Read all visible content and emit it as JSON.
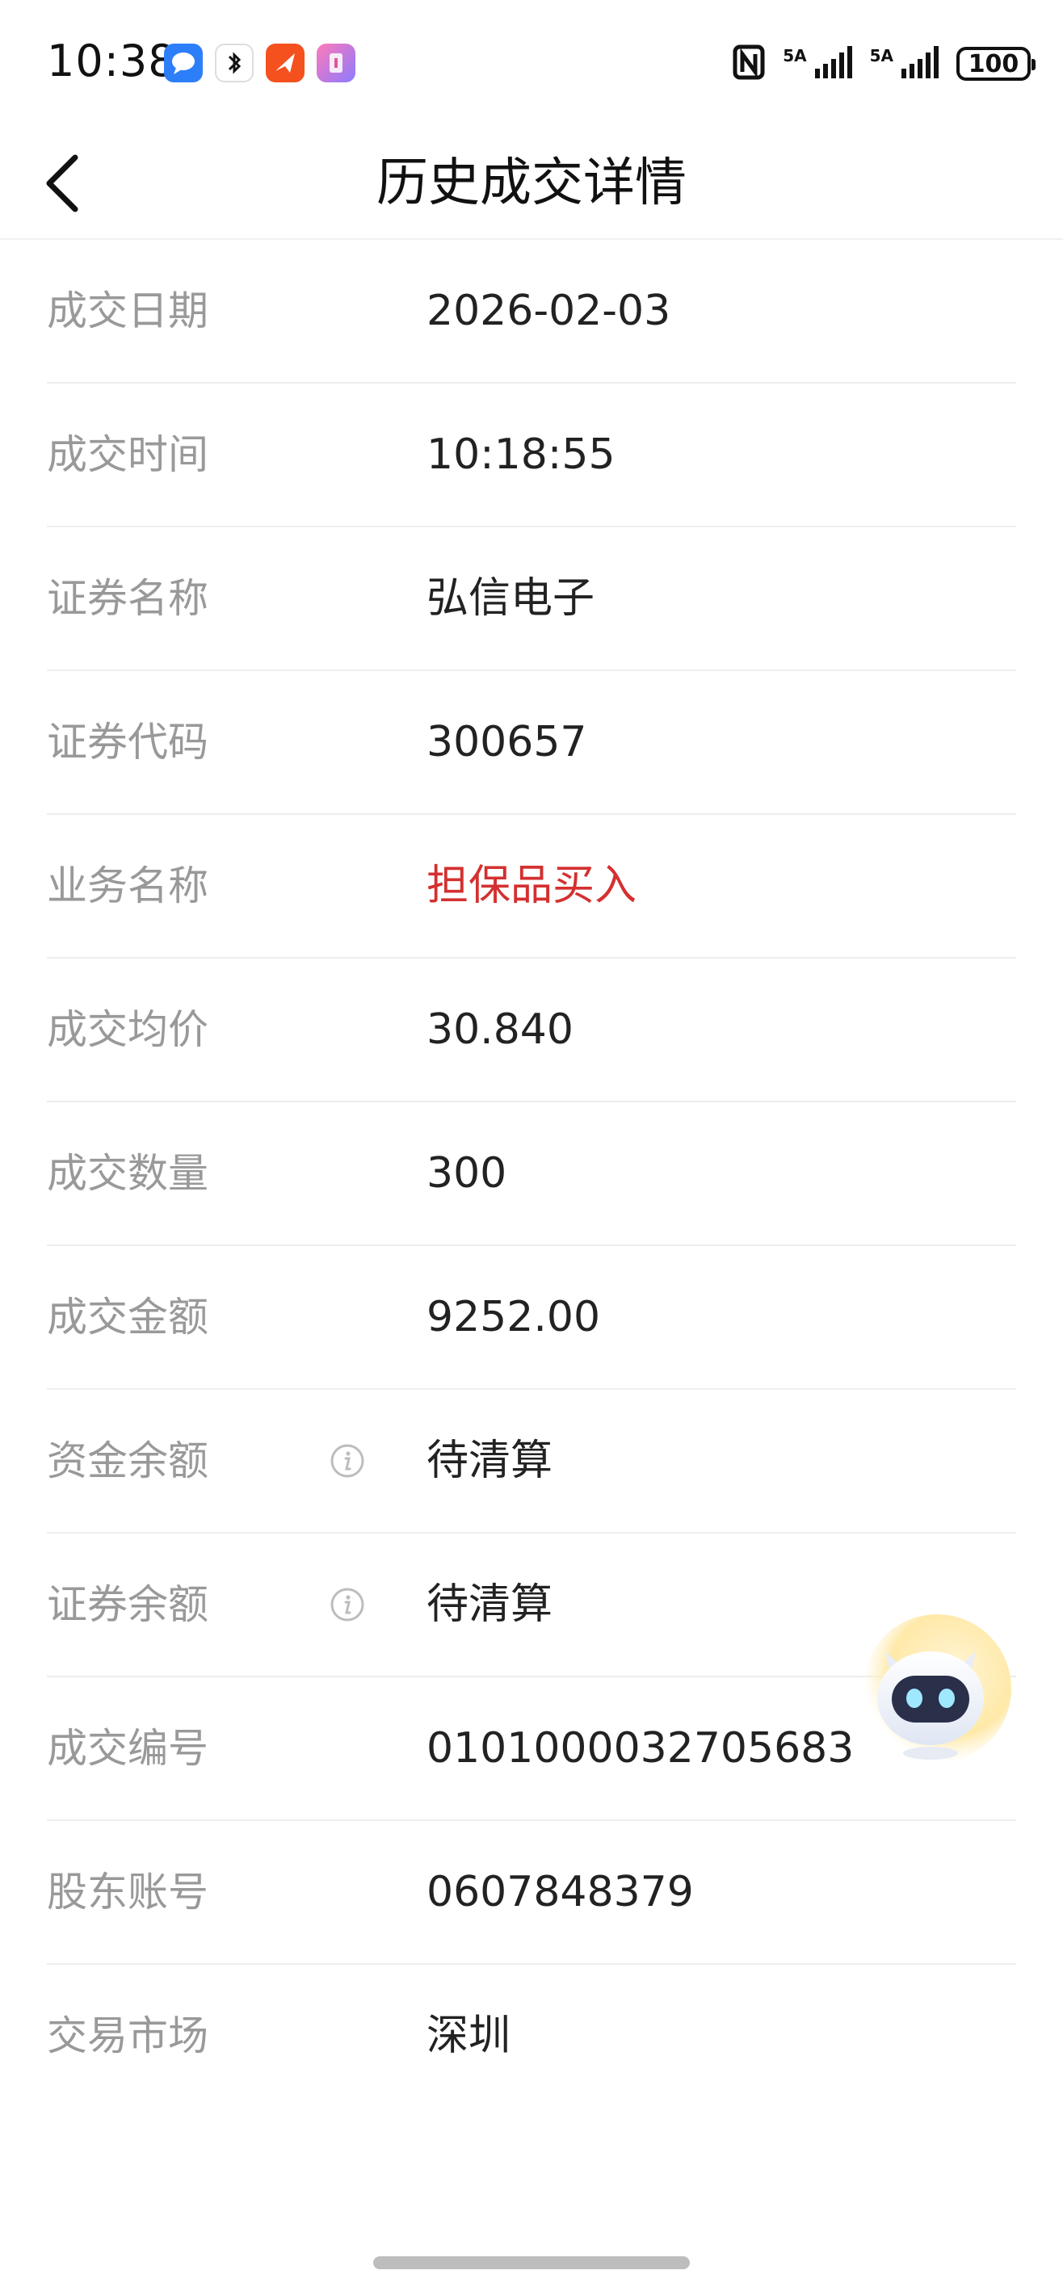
{
  "status_bar": {
    "time": "10:38",
    "network_1": "5A",
    "network_2": "5A",
    "battery": "100"
  },
  "header": {
    "title": "历史成交详情"
  },
  "details": [
    {
      "label": "成交日期",
      "value": "2026-02-03"
    },
    {
      "label": "成交时间",
      "value": "10:18:55"
    },
    {
      "label": "证券名称",
      "value": "弘信电子"
    },
    {
      "label": "证券代码",
      "value": "300657"
    },
    {
      "label": "业务名称",
      "value": "担保品买入"
    },
    {
      "label": "成交均价",
      "value": "30.840"
    },
    {
      "label": "成交数量",
      "value": "300"
    },
    {
      "label": "成交金额",
      "value": "9252.00"
    },
    {
      "label": "资金余额",
      "value": "待清算"
    },
    {
      "label": "证券余额",
      "value": "待清算"
    },
    {
      "label": "成交编号",
      "value": "0101000032705683"
    },
    {
      "label": "股东账号",
      "value": "0607848379"
    },
    {
      "label": "交易市场",
      "value": "深圳"
    }
  ],
  "colors": {
    "business_name_value": "#d43030",
    "label": "#999999",
    "value": "#222222"
  }
}
